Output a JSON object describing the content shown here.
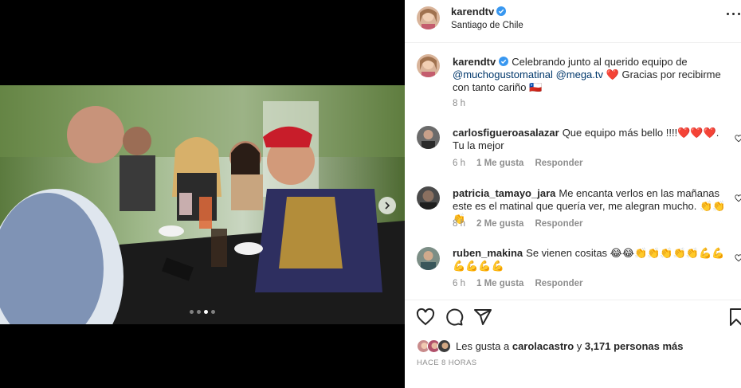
{
  "post": {
    "author": "karendtv",
    "location": "Santiago de Chile",
    "caption_text": "Celebrando junto al querido equipo de",
    "caption_mention_1": "@muchogustomatinal",
    "caption_mention_2": "@mega.tv",
    "caption_heart": "❤️",
    "caption_rest": "Gracias por recibirme con tanto cariño",
    "caption_flag": "🇨🇱",
    "caption_time": "8 h"
  },
  "carousel": {
    "slide_count": 4,
    "active_slide": 3
  },
  "comments": [
    {
      "username": "carlosfigueroasalazar",
      "text": "Que equipo más bello !!!!❤️❤️❤️. Tu la mejor",
      "time": "6 h",
      "likes": "1 Me gusta",
      "reply": "Responder"
    },
    {
      "username": "patricia_tamayo_jara",
      "text": "Me encanta verlos en las mañanas este es el matinal que quería ver, me alegran mucho. 👏👏👏",
      "time": "8 h",
      "likes": "2 Me gusta",
      "reply": "Responder"
    },
    {
      "username": "ruben_makina",
      "text": "Se vienen cositas 😂😂👏👏👏👏👏💪💪💪💪💪💪",
      "time": "6 h",
      "likes": "1 Me gusta",
      "reply": "Responder"
    }
  ],
  "likes": {
    "prefix": "Les gusta a",
    "user": "carolacastro",
    "joiner": "y",
    "count": "3,171 personas más"
  },
  "time_ago": "HACE 8 HORAS",
  "colors": {
    "verified": "#3897f0",
    "text": "#262626",
    "muted": "#8e8e8e",
    "mention": "#00376b",
    "heart": "#ed4956"
  },
  "icons": [
    "verified-badge-icon",
    "more-options-icon",
    "heart-icon",
    "comment-icon",
    "share-icon",
    "bookmark-icon",
    "chevron-right-icon"
  ]
}
